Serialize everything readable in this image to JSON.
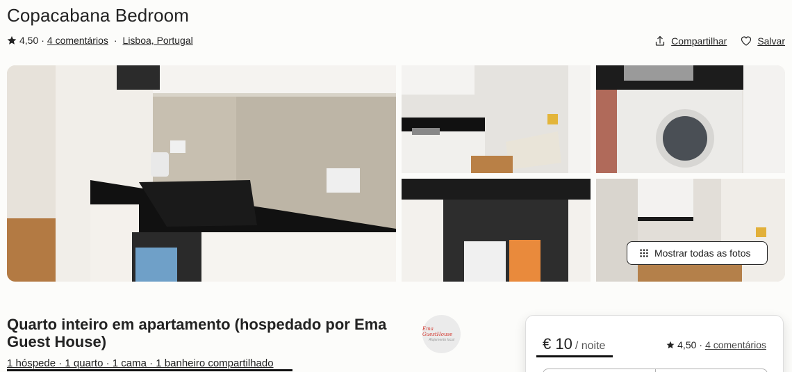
{
  "listing": {
    "title": "Copacabana Bedroom",
    "rating": "4,50",
    "reviews": "4 comentários",
    "location": "Lisboa, Portugal",
    "dot": "·"
  },
  "actions": {
    "share": "Compartilhar",
    "save": "Salvar"
  },
  "gallery": {
    "show_all": "Mostrar todas as fotos",
    "photos": [
      "kitchen-counter",
      "kitchen-overview",
      "washing-machine",
      "oven",
      "kitchen-corner"
    ]
  },
  "details": {
    "heading": "Quarto inteiro em apartamento (hospedado por Ema Guest House)",
    "summary": "1 hóspede · 1 quarto · 1 cama · 1 banheiro compartilhado",
    "host_avatar_line1": "Ema GuestHouse",
    "host_avatar_line2": "Alojamento local"
  },
  "booking": {
    "price": "€ 10",
    "per": "/ noite",
    "rating": "4,50",
    "reviews": "4 comentários"
  },
  "colors": {
    "text": "#222222",
    "background": "#fcfcfa",
    "border": "#dddddd"
  }
}
